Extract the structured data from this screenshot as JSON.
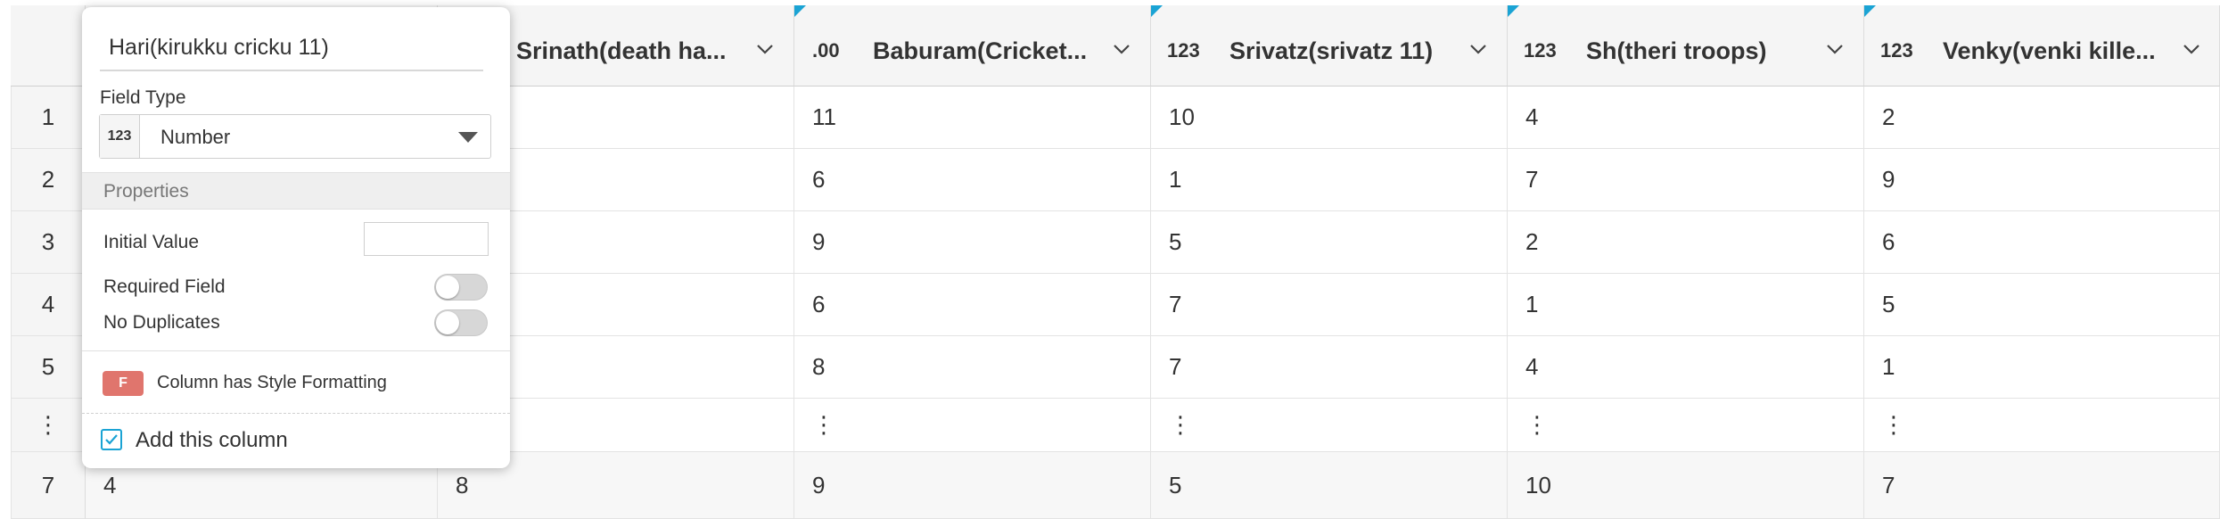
{
  "columns": [
    {
      "type": "",
      "title": "Hari(kirukku cricku 11)",
      "flag": false
    },
    {
      "type": "",
      "title": "Srinath(death ha...",
      "flag": false
    },
    {
      "type": ".00",
      "title": "Baburam(Cricket...",
      "flag": true
    },
    {
      "type": "123",
      "title": "Srivatz(srivatz 11)",
      "flag": true
    },
    {
      "type": "123",
      "title": "Sh(theri troops)",
      "flag": true
    },
    {
      "type": "123",
      "title": "Venky(venki kille...",
      "flag": true
    }
  ],
  "rows": [
    {
      "num": "1",
      "cells": [
        "",
        "",
        "11",
        "10",
        "4",
        "2"
      ]
    },
    {
      "num": "2",
      "cells": [
        "",
        "",
        "6",
        "1",
        "7",
        "9"
      ]
    },
    {
      "num": "3",
      "cells": [
        "",
        "",
        "9",
        "5",
        "2",
        "6"
      ]
    },
    {
      "num": "4",
      "cells": [
        "",
        "",
        "6",
        "7",
        "1",
        "5"
      ]
    },
    {
      "num": "5",
      "cells": [
        "",
        "",
        "8",
        "7",
        "4",
        "1"
      ]
    },
    {
      "num": "⋮",
      "cells": [
        "",
        "",
        "⋮",
        "⋮",
        "⋮",
        "⋮"
      ]
    },
    {
      "num": "7",
      "cells": [
        "4",
        "8",
        "9",
        "5",
        "10",
        "7"
      ]
    }
  ],
  "panel": {
    "column_name": "Hari(kirukku cricku 11)",
    "field_type_label": "Field Type",
    "field_type_badge": "123",
    "field_type_value": "Number",
    "properties_label": "Properties",
    "initial_value_label": "Initial Value",
    "initial_value": "",
    "required_label": "Required Field",
    "required_on": false,
    "no_duplicates_label": "No Duplicates",
    "no_duplicates_on": false,
    "style_badge": "F",
    "style_label": "Column has Style Formatting",
    "add_column_label": "Add this column",
    "add_column_checked": true
  },
  "colors": {
    "accent": "#1aa3d4",
    "style_badge": "#e0756d",
    "header_bg": "#f5f5f5"
  }
}
